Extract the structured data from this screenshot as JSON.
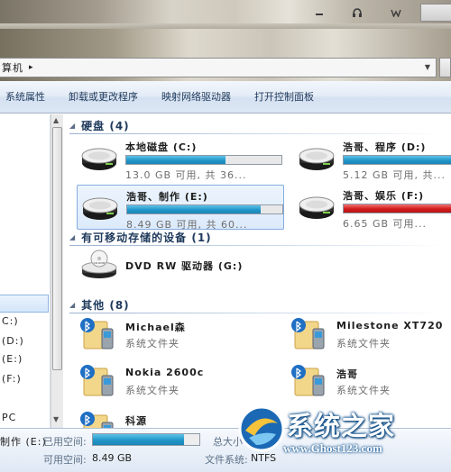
{
  "window": {
    "title_controls": [
      "minimize",
      "maximize",
      "close"
    ]
  },
  "address": {
    "crumb": "算机",
    "separator": "▸"
  },
  "commands": [
    "系统属性",
    "卸载或更改程序",
    "映射网络驱动器",
    "打开控制面板"
  ],
  "nav": {
    "items": [
      "C:)",
      "(D:)",
      "(E:)",
      "(F:)",
      "PC"
    ]
  },
  "groups": {
    "hard_disks": "硬盘 (4)",
    "removable": "有可移动存储的设备 (1)",
    "other": "其他 (8)"
  },
  "drives": [
    {
      "name": "本地磁盘 (C:)",
      "info": "13.0 GB 可用, 共 36...",
      "used_fraction": 0.64,
      "bar_color": "#2196c8"
    },
    {
      "name": "浩哥、程序 (D:)",
      "info": "5.12 GB 可用, 共...",
      "used_fraction": 0.93,
      "bar_color": "#2196c8"
    },
    {
      "name": "浩哥、制作 (E:)",
      "info": "8.49 GB 可用, 共 60...",
      "used_fraction": 0.86,
      "bar_color": "#2196c8"
    },
    {
      "name": "浩哥、娱乐 (F:)",
      "info": "6.65 GB 可用...",
      "used_fraction": 0.95,
      "bar_color": "#d21b1b"
    }
  ],
  "removable": {
    "name": "DVD RW 驱动器 (G:)",
    "icon_label": "CD-ROM"
  },
  "others": [
    {
      "name": "Michael森",
      "type": "系统文件夹"
    },
    {
      "name": "Milestone XT720",
      "type": "系统文件夹"
    },
    {
      "name": "Nokia 2600c",
      "type": "系统文件夹"
    },
    {
      "name": "浩哥",
      "type": "系统文件夹"
    },
    {
      "name": "科源",
      "type": ""
    }
  ],
  "details": {
    "name": "制作 (E:)",
    "used_label": "已用空间:",
    "free_label": "可用空间:",
    "free_value": "8.49 GB",
    "total_label": "总大小",
    "fs_label": "文件系统:",
    "fs_value": "NTFS",
    "used_fraction": 0.86
  },
  "watermark": {
    "cn": "系统之家",
    "url": "www.Ghost123.com"
  }
}
